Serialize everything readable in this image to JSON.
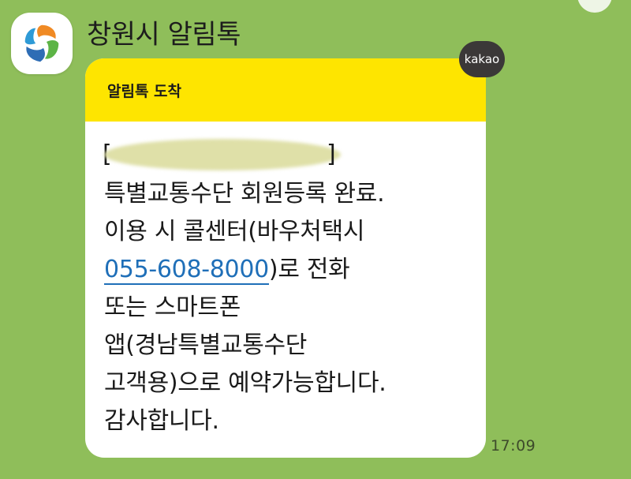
{
  "sender": {
    "name": "창원시 알림톡",
    "avatar_icon": "changwon-city-logo-icon"
  },
  "badge": {
    "label": "kakao"
  },
  "message": {
    "header_title": "알림톡 도착",
    "lines": [
      "특별교통수단 회원등록 완료.",
      "이용 시 콜센터(바우처택시",
      "",
      "또는 스마트폰",
      "앱(경남특별교통수단",
      "고객용)으로 예약가능합니다.",
      "감사합니다."
    ],
    "phone_number": "055-608-8000",
    "phone_suffix": ")로 전화",
    "masked_open": "[",
    "masked_close": "]"
  },
  "timestamp": "17:09",
  "colors": {
    "background": "#8fbe5a",
    "header_yellow": "#fee500",
    "link_blue": "#1f6fb8",
    "badge_dark": "#3b3838"
  }
}
